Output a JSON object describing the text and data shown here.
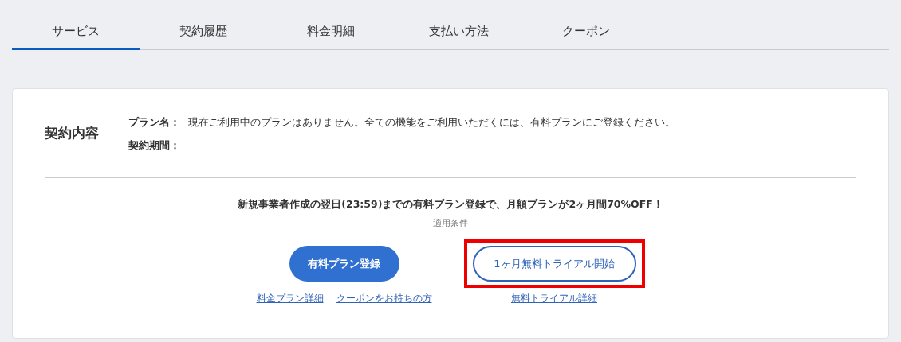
{
  "tabs": [
    {
      "label": "サービス",
      "selected": true
    },
    {
      "label": "契約履歴",
      "selected": false
    },
    {
      "label": "料金明細",
      "selected": false
    },
    {
      "label": "支払い方法",
      "selected": false
    },
    {
      "label": "クーポン",
      "selected": false
    }
  ],
  "contract": {
    "heading": "契約内容",
    "fields": [
      {
        "label": "プラン名：",
        "value": "現在ご利用中のプランはありません。全ての機能をご利用いただくには、有料プランにご登録ください。"
      },
      {
        "label": "契約期間：",
        "value": "-"
      }
    ]
  },
  "promo": {
    "text": "新規事業者作成の翌日(23:59)までの有料プラン登録で、月額プランが2ヶ月間70%OFF！",
    "conditions_link": "適用条件"
  },
  "actions": [
    {
      "kind": "primary",
      "button": "有料プラン登録",
      "highlighted": false,
      "links": [
        "料金プラン詳細",
        "クーポンをお持ちの方"
      ]
    },
    {
      "kind": "outline",
      "button": "1ヶ月無料トライアル開始",
      "highlighted": true,
      "links": [
        "無料トライアル詳細"
      ]
    }
  ]
}
